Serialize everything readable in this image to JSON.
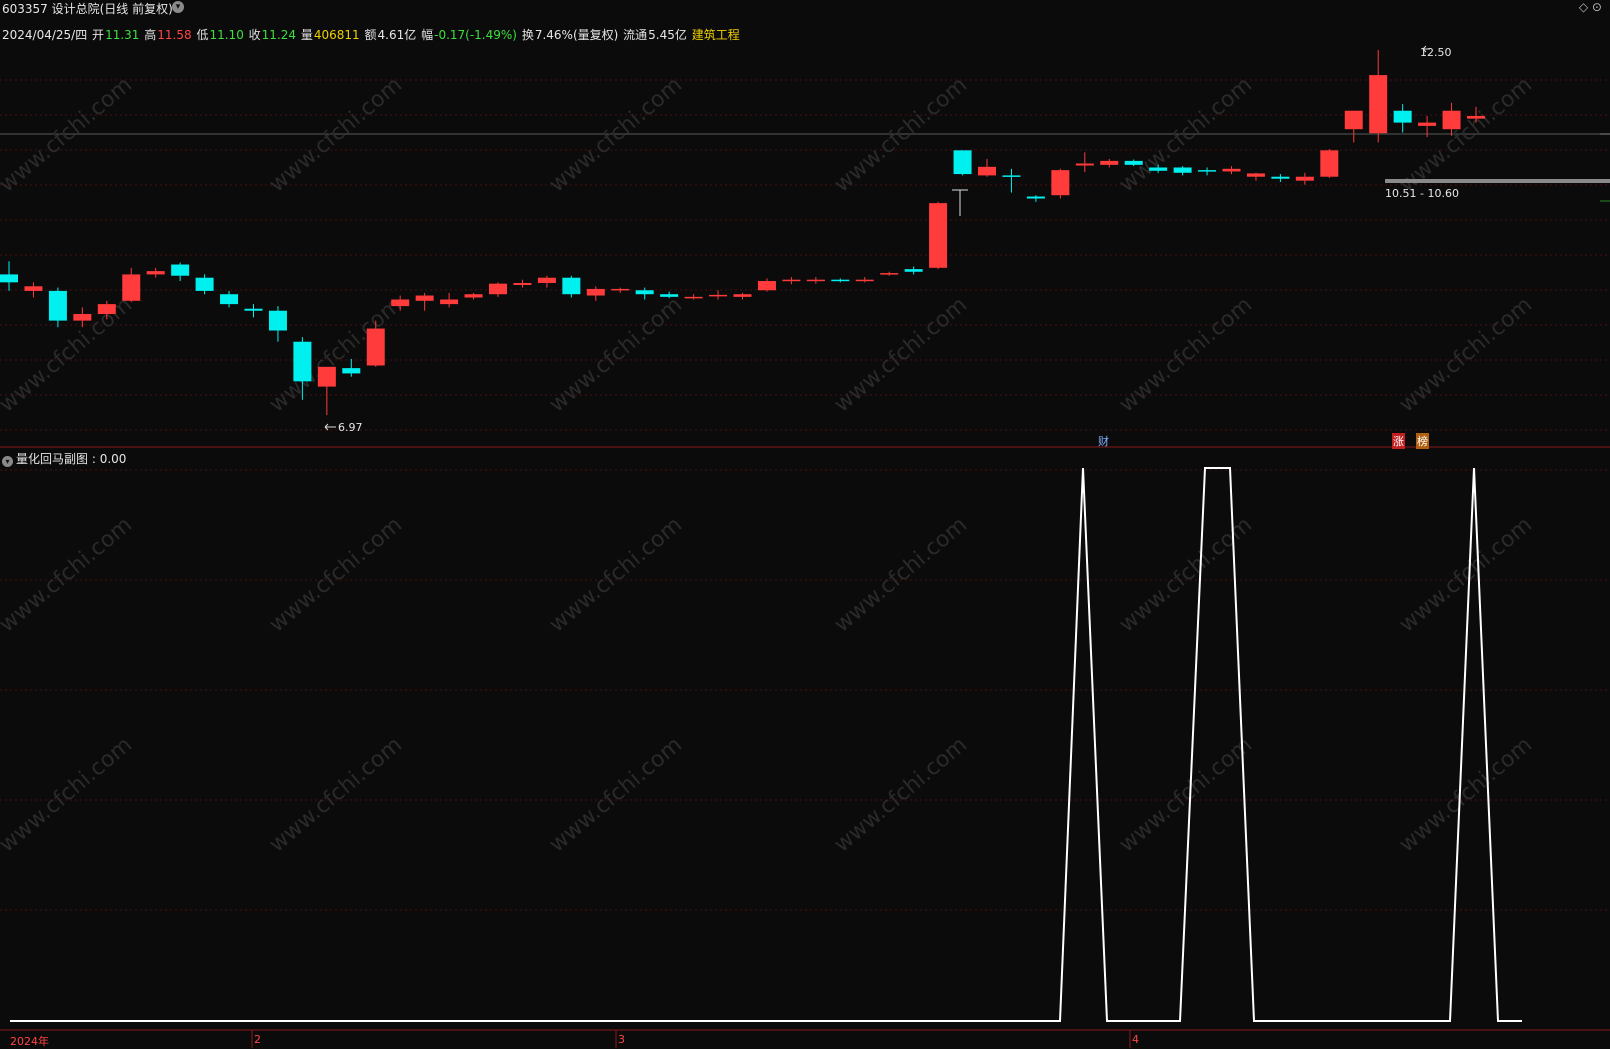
{
  "header": {
    "title": "603357 设计总院(日线 前复权)",
    "corner_icons": "◇ ⊙"
  },
  "quote": {
    "date": "2024/04/25/四",
    "open_label": "开",
    "open": "11.31",
    "high_label": "高",
    "high": "11.58",
    "low_label": "低",
    "low": "11.10",
    "close_label": "收",
    "close": "11.24",
    "volume_label": "量",
    "volume": "406811",
    "amount_label": "额",
    "amount": "4.61亿",
    "change_label": "幅",
    "change": "-0.17(-1.49%)",
    "turnover_label": "换",
    "turnover": "7.46%(量复权)",
    "float_label": "流通",
    "float": "5.45亿",
    "sector": "建筑工程"
  },
  "main_chart": {
    "high_marker": "12.50",
    "low_marker": "6.97",
    "range_marker": "10.51 - 10.60",
    "badges": {
      "cai": "财",
      "zhang": "涨",
      "bang": "榜"
    },
    "up_color": "#ff3b3b",
    "down_color": "#00f0f0"
  },
  "sub_chart": {
    "title": "量化回马副图",
    "value": ": 0.00"
  },
  "xaxis": {
    "year": "2024年",
    "m2": "2",
    "m3": "3",
    "m4": "4"
  },
  "watermark": "www.cfchi.com",
  "chart_data": {
    "type": "candlestick",
    "candles": [
      {
        "o": 9.1,
        "h": 9.3,
        "l": 8.85,
        "c": 8.98
      },
      {
        "o": 8.85,
        "h": 8.98,
        "l": 8.75,
        "c": 8.92
      },
      {
        "o": 8.85,
        "h": 8.9,
        "l": 8.3,
        "c": 8.4
      },
      {
        "o": 8.4,
        "h": 8.6,
        "l": 8.3,
        "c": 8.5
      },
      {
        "o": 8.5,
        "h": 8.7,
        "l": 8.42,
        "c": 8.65
      },
      {
        "o": 8.7,
        "h": 9.2,
        "l": 8.68,
        "c": 9.1
      },
      {
        "o": 9.1,
        "h": 9.2,
        "l": 9.05,
        "c": 9.15
      },
      {
        "o": 9.25,
        "h": 9.28,
        "l": 9.0,
        "c": 9.08
      },
      {
        "o": 9.05,
        "h": 9.1,
        "l": 8.8,
        "c": 8.85
      },
      {
        "o": 8.8,
        "h": 8.85,
        "l": 8.6,
        "c": 8.65
      },
      {
        "o": 8.58,
        "h": 8.65,
        "l": 8.45,
        "c": 8.55
      },
      {
        "o": 8.55,
        "h": 8.62,
        "l": 8.08,
        "c": 8.25
      },
      {
        "o": 8.08,
        "h": 8.15,
        "l": 7.2,
        "c": 7.48
      },
      {
        "o": 7.4,
        "h": 7.6,
        "l": 6.97,
        "c": 7.7
      },
      {
        "o": 7.68,
        "h": 7.82,
        "l": 7.55,
        "c": 7.6
      },
      {
        "o": 7.72,
        "h": 8.4,
        "l": 7.7,
        "c": 8.28
      },
      {
        "o": 8.62,
        "h": 8.78,
        "l": 8.55,
        "c": 8.72
      },
      {
        "o": 8.7,
        "h": 8.82,
        "l": 8.55,
        "c": 8.78
      },
      {
        "o": 8.65,
        "h": 8.82,
        "l": 8.6,
        "c": 8.72
      },
      {
        "o": 8.75,
        "h": 8.82,
        "l": 8.72,
        "c": 8.8
      },
      {
        "o": 8.8,
        "h": 8.98,
        "l": 8.76,
        "c": 8.96
      },
      {
        "o": 8.94,
        "h": 9.02,
        "l": 8.9,
        "c": 8.97
      },
      {
        "o": 8.97,
        "h": 9.08,
        "l": 8.9,
        "c": 9.05
      },
      {
        "o": 9.05,
        "h": 9.08,
        "l": 8.75,
        "c": 8.8
      },
      {
        "o": 8.78,
        "h": 8.92,
        "l": 8.7,
        "c": 8.88
      },
      {
        "o": 8.86,
        "h": 8.9,
        "l": 8.82,
        "c": 8.88
      },
      {
        "o": 8.86,
        "h": 8.9,
        "l": 8.72,
        "c": 8.8
      },
      {
        "o": 8.8,
        "h": 8.84,
        "l": 8.74,
        "c": 8.76
      },
      {
        "o": 8.74,
        "h": 8.8,
        "l": 8.72,
        "c": 8.76
      },
      {
        "o": 8.78,
        "h": 8.86,
        "l": 8.72,
        "c": 8.79
      },
      {
        "o": 8.76,
        "h": 8.82,
        "l": 8.72,
        "c": 8.8
      },
      {
        "o": 8.86,
        "h": 9.04,
        "l": 8.84,
        "c": 9.0
      },
      {
        "o": 9.0,
        "h": 9.06,
        "l": 8.95,
        "c": 9.02
      },
      {
        "o": 9.02,
        "h": 9.06,
        "l": 8.96,
        "c": 9.02
      },
      {
        "o": 9.02,
        "h": 9.04,
        "l": 8.98,
        "c": 9.0
      },
      {
        "o": 9.0,
        "h": 9.06,
        "l": 8.98,
        "c": 9.02
      },
      {
        "o": 9.1,
        "h": 9.14,
        "l": 9.08,
        "c": 9.12
      },
      {
        "o": 9.18,
        "h": 9.22,
        "l": 9.1,
        "c": 9.14
      },
      {
        "o": 9.2,
        "h": 10.2,
        "l": 9.18,
        "c": 10.18
      },
      {
        "o": 10.98,
        "h": 10.98,
        "l": 10.6,
        "c": 10.62
      },
      {
        "o": 10.6,
        "h": 10.85,
        "l": 10.58,
        "c": 10.73
      },
      {
        "o": 10.6,
        "h": 10.7,
        "l": 10.34,
        "c": 10.58
      },
      {
        "o": 10.28,
        "h": 10.3,
        "l": 10.2,
        "c": 10.25
      },
      {
        "o": 10.3,
        "h": 10.7,
        "l": 10.25,
        "c": 10.68
      },
      {
        "o": 10.75,
        "h": 10.95,
        "l": 10.65,
        "c": 10.78
      },
      {
        "o": 10.76,
        "h": 10.85,
        "l": 10.72,
        "c": 10.82
      },
      {
        "o": 10.82,
        "h": 10.84,
        "l": 10.74,
        "c": 10.76
      },
      {
        "o": 10.72,
        "h": 10.76,
        "l": 10.64,
        "c": 10.67
      },
      {
        "o": 10.72,
        "h": 10.74,
        "l": 10.6,
        "c": 10.64
      },
      {
        "o": 10.68,
        "h": 10.72,
        "l": 10.6,
        "c": 10.66
      },
      {
        "o": 10.66,
        "h": 10.74,
        "l": 10.62,
        "c": 10.7
      },
      {
        "o": 10.58,
        "h": 10.64,
        "l": 10.52,
        "c": 10.63
      },
      {
        "o": 10.58,
        "h": 10.62,
        "l": 10.5,
        "c": 10.55
      },
      {
        "o": 10.52,
        "h": 10.64,
        "l": 10.46,
        "c": 10.58
      },
      {
        "o": 10.58,
        "h": 11.0,
        "l": 10.56,
        "c": 10.98
      },
      {
        "o": 11.3,
        "h": 11.58,
        "l": 11.1,
        "c": 11.58
      },
      {
        "o": 11.24,
        "h": 12.5,
        "l": 11.1,
        "c": 12.12
      },
      {
        "o": 11.58,
        "h": 11.68,
        "l": 11.25,
        "c": 11.4
      },
      {
        "o": 11.35,
        "h": 11.5,
        "l": 11.18,
        "c": 11.4
      },
      {
        "o": 11.3,
        "h": 11.7,
        "l": 11.2,
        "c": 11.58
      },
      {
        "o": 11.46,
        "h": 11.64,
        "l": 11.4,
        "c": 11.5
      }
    ],
    "indicator": {
      "name": "量化回马副图",
      "signal_peaks": [
        "2024-03-27",
        "2024-04-08 to 2024-04-09",
        "2024-04-24"
      ],
      "ylim": [
        0,
        1
      ]
    }
  }
}
